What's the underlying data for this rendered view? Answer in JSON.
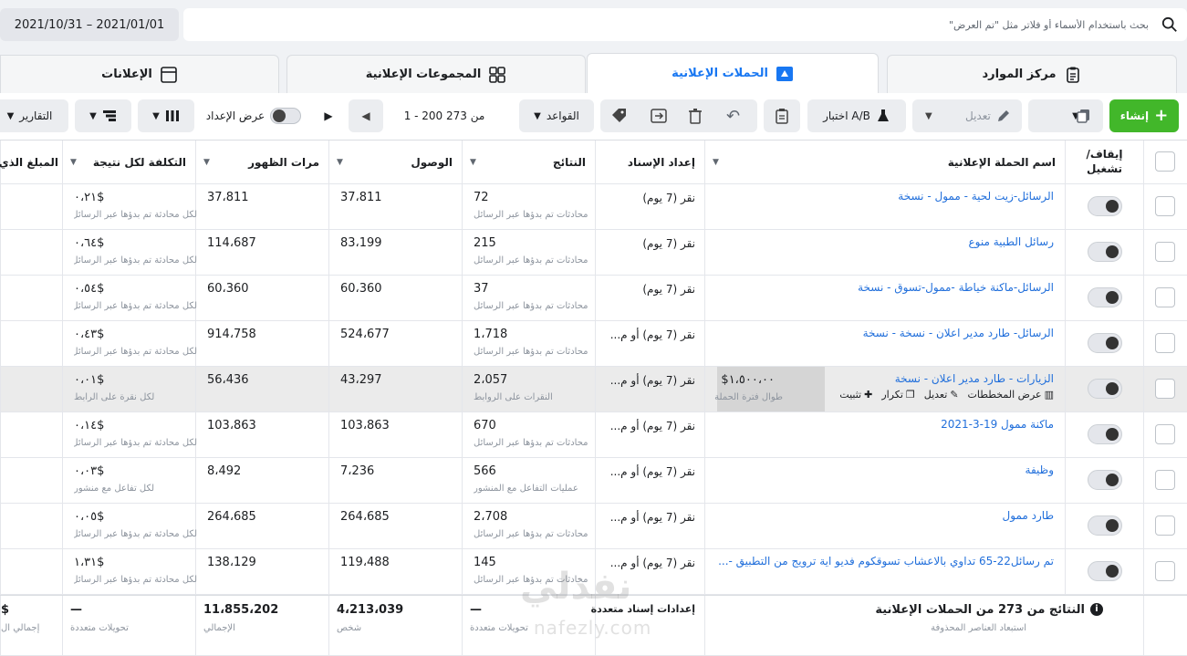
{
  "date_range": "2021/10/31 – 2021/01/01",
  "search": {
    "placeholder": "بحث باستخدام الأسماء أو فلاتر مثل \"تم العرض\""
  },
  "tabs": [
    {
      "label": "مركز الموارد",
      "icon": "clipboard-icon"
    },
    {
      "label": "الحملات الإعلانية",
      "icon": "campaign-icon",
      "active": true
    },
    {
      "label": "المجموعات الإعلانية",
      "icon": "grid-icon"
    },
    {
      "label": "الإعلانات",
      "icon": "ad-icon"
    }
  ],
  "toolbar": {
    "create_label": "إنشاء",
    "edit_label": "تعديل",
    "ab_test_label": "اختبار A/B",
    "rules_label": "القواعد",
    "pagination": "1 - 200 من 273",
    "view_setup_label": "عرض الإعداد",
    "reports_label": "التقارير"
  },
  "columns": {
    "toggle": "إيقاف/ تشغيل",
    "name": "اسم الحملة الإعلانية",
    "attribution": "إعداد الإسناد",
    "results": "النتائج",
    "reach": "الوصول",
    "impressions": "مرات الظهور",
    "cost": "التكلفة لكل نتيجة",
    "spent": "المبلغ الذي"
  },
  "rows": [
    {
      "name": "الرسائل-زيت لحية - ممول - نسخة",
      "attribution": "نقر (7 يوم)",
      "results": "72",
      "results_sub": "محادثات تم بدؤها عبر الرسائل",
      "reach": "37،811",
      "impressions": "37،811",
      "cost": "٠،٢١$",
      "cost_sub": "لكل محادثة تم بدؤها عبر الرسائل"
    },
    {
      "name": "رسائل الطبية منوع",
      "attribution": "نقر (7 يوم)",
      "results": "215",
      "results_sub": "محادثات تم بدؤها عبر الرسائل",
      "reach": "83،199",
      "impressions": "114،687",
      "cost": "٠،٦٤$",
      "cost_sub": "لكل محادثة تم بدؤها عبر الرسائل"
    },
    {
      "name": "الرسائل-ماكنة خياطة -ممول-تسوق - نسخة",
      "attribution": "نقر (7 يوم)",
      "results": "37",
      "results_sub": "محادثات تم بدؤها عبر الرسائل",
      "reach": "60،360",
      "impressions": "60،360",
      "cost": "٠،٥٤$",
      "cost_sub": "لكل محادثة تم بدؤها عبر الرسائل"
    },
    {
      "name": "الرسائل- طارد مدير اعلان - نسخة - نسخة",
      "attribution": "نقر (7 يوم) أو م...",
      "results": "1،718",
      "results_sub": "محادثات تم بدؤها عبر الرسائل",
      "reach": "524،677",
      "impressions": "914،758",
      "cost": "٠،٤٣$",
      "cost_sub": "لكل محادثة تم بدؤها عبر الرسائل"
    },
    {
      "name": "الزيارات - طارد مدير اعلان - نسخة",
      "attribution": "نقر (7 يوم) أو م...",
      "results": "2،057",
      "results_sub": "النقرات على الروابط",
      "reach": "43،297",
      "impressions": "56،436",
      "cost": "٠،٠١$",
      "cost_sub": "لكل نقرة على الرابط",
      "highlight": true,
      "budget": "١،٥٠٠،٠٠$",
      "budget_sub": "طوال فترة الحملة",
      "actions": [
        "عرض المخططات",
        "تعديل",
        "تكرار",
        "تثبيت"
      ]
    },
    {
      "name": "ماكنة ممول 19-3-2021",
      "attribution": "نقر (7 يوم) أو م...",
      "results": "670",
      "results_sub": "محادثات تم بدؤها عبر الرسائل",
      "reach": "103،863",
      "impressions": "103،863",
      "cost": "٠،١٤$",
      "cost_sub": "لكل محادثة تم بدؤها عبر الرسائل"
    },
    {
      "name": "وظيفة",
      "attribution": "نقر (7 يوم) أو م...",
      "results": "566",
      "results_sub": "عمليات التفاعل مع المنشور",
      "reach": "7،236",
      "impressions": "8،492",
      "cost": "٠،٠٣$",
      "cost_sub": "لكل تفاعل مع منشور"
    },
    {
      "name": "طارد ممول",
      "attribution": "نقر (7 يوم) أو م...",
      "results": "2،708",
      "results_sub": "محادثات تم بدؤها عبر الرسائل",
      "reach": "264،685",
      "impressions": "264،685",
      "cost": "٠،٠٥$",
      "cost_sub": "لكل محادثة تم بدؤها عبر الرسائل"
    },
    {
      "name": "تم رسائل22-65 تداوي بالاعشاب تسوقكوم فديو اية ترويج من التطبيق -...",
      "attribution": "نقر (7 يوم) أو م...",
      "results": "145",
      "results_sub": "محادثات تم بدؤها عبر الرسائل",
      "reach": "119،488",
      "impressions": "138،129",
      "cost": "١،٣١$",
      "cost_sub": "لكل محادثة تم بدؤها عبر الرسائل"
    }
  ],
  "totals": {
    "label": "النتائج من 273 من الحملات الإعلانية",
    "label_sub": "استبعاد العناصر المحذوفة",
    "attribution": "إعدادات إسناد متعددة",
    "results": "—",
    "results_sub": "تحويلات متعددة",
    "reach": "4،213،039",
    "reach_sub": "شخص",
    "impressions": "11،855،202",
    "impressions_sub": "الإجمالي",
    "cost": "—",
    "cost_sub": "تحويلات متعددة",
    "spent": "$",
    "spent_sub": "إجمالي ال"
  },
  "watermark": {
    "arabic": "نفذلي",
    "latin": "nafezly.com"
  },
  "colors": {
    "accent": "#1877f2",
    "create": "#42b72a",
    "link": "#216fdb"
  }
}
